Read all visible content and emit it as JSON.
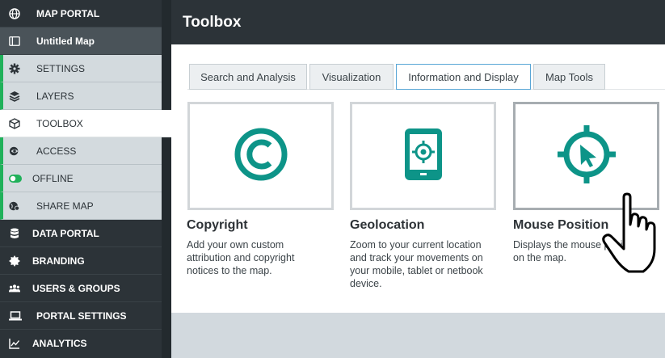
{
  "sidebar": {
    "items": [
      {
        "label": "MAP PORTAL",
        "icon": "globe-icon"
      },
      {
        "label": "Untitled Map",
        "icon": "map-book-icon"
      },
      {
        "label": "SETTINGS",
        "icon": "gear-icon"
      },
      {
        "label": "LAYERS",
        "icon": "layers-icon"
      },
      {
        "label": "TOOLBOX",
        "icon": "box-icon"
      },
      {
        "label": "ACCESS",
        "icon": "eye-icon"
      },
      {
        "label": "OFFLINE",
        "icon": "toggle-icon"
      },
      {
        "label": "SHARE MAP",
        "icon": "share-globe-icon"
      },
      {
        "label": "DATA PORTAL",
        "icon": "database-icon"
      },
      {
        "label": "BRANDING",
        "icon": "badge-icon"
      },
      {
        "label": "USERS & GROUPS",
        "icon": "users-icon"
      },
      {
        "label": "PORTAL SETTINGS",
        "icon": "laptop-icon"
      },
      {
        "label": "ANALYTICS",
        "icon": "chart-icon"
      }
    ]
  },
  "header": {
    "title": "Toolbox"
  },
  "tabs": [
    {
      "label": "Search and Analysis"
    },
    {
      "label": "Visualization"
    },
    {
      "label": "Information and Display"
    },
    {
      "label": "Map Tools"
    }
  ],
  "active_tab": "Information and Display",
  "tools": [
    {
      "title": "Copyright",
      "description": "Add your own custom attribution and copyright notices to the map.",
      "icon": "copyright-icon"
    },
    {
      "title": "Geolocation",
      "description": "Zoom to your current location and track your movements on your mobile, tablet or netbook device.",
      "icon": "geolocation-tablet-icon"
    },
    {
      "title": "Mouse Position",
      "description": "Displays the mouse position on the map.",
      "icon": "crosshair-pointer-icon"
    }
  ],
  "colors": {
    "accent": "#0d9488",
    "sidebar": "#2c3338",
    "sub_item": "#d3dade",
    "indicator": "#20b15a",
    "active_tab_border": "#58a6d6"
  }
}
